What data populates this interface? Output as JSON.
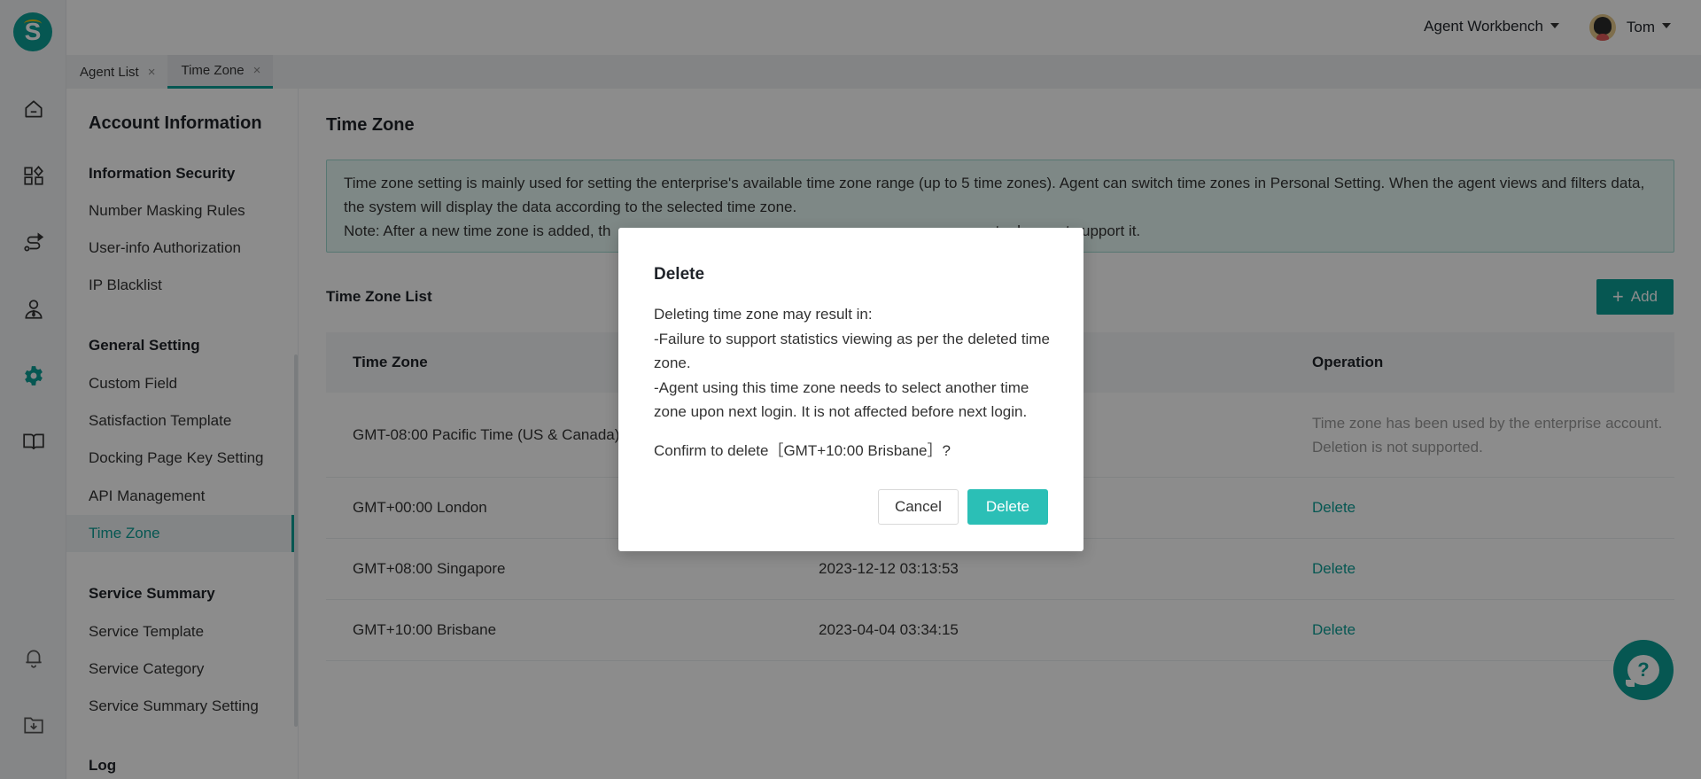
{
  "app": {
    "logo_letter": "S",
    "workbench_label": "Agent Workbench",
    "user_name": "Tom",
    "accent_color": "#0b9e96"
  },
  "rail": {
    "items": [
      {
        "icon": "home-icon",
        "active": false
      },
      {
        "icon": "apps-icon",
        "active": false
      },
      {
        "icon": "route-icon",
        "active": false
      },
      {
        "icon": "agent-icon",
        "active": false
      },
      {
        "icon": "gear-icon",
        "active": true
      },
      {
        "icon": "book-icon",
        "active": false
      }
    ],
    "bottom_items": [
      {
        "icon": "bell-icon"
      },
      {
        "icon": "download-folder-icon"
      }
    ]
  },
  "tabs": [
    {
      "label": "Agent List",
      "close": "×",
      "active": false
    },
    {
      "label": "Time Zone",
      "close": "×",
      "active": true
    }
  ],
  "sidebar": {
    "title": "Account Information",
    "groups": [
      {
        "label": "Information Security",
        "items": [
          "Number Masking Rules",
          "User-info Authorization",
          "IP Blacklist"
        ]
      },
      {
        "label": "General Setting",
        "items": [
          "Custom Field",
          "Satisfaction Template",
          "Docking Page Key Setting",
          "API Management",
          "Time Zone"
        ]
      },
      {
        "label": "Service Summary",
        "items": [
          "Service Template",
          "Service Category",
          "Service Summary Setting"
        ]
      },
      {
        "label": "Log",
        "items": []
      }
    ],
    "active_item": "Time Zone"
  },
  "main": {
    "title": "Time Zone",
    "notice_line1": "Time zone setting is mainly used for setting the enterprise's available time zone range (up to 5 time zones). Agent can switch time zones in Personal Setting. When the agent views and filters data, the system will display the data according to the selected time zone.",
    "notice_line2_visible_start": "Note: After a new time zone is added, th",
    "notice_line2_visible_end": "ata does not support it.",
    "list_title": "Time Zone List",
    "add_label": "Add",
    "add_icon": "+",
    "columns": [
      "Time Zone",
      "",
      "Operation"
    ],
    "rows": [
      {
        "time_zone": "GMT-08:00 Pacific Time (US & Canada)",
        "time": "",
        "operation": "Time zone has been used by the enterprise account. Deletion is not supported.",
        "op_type": "text"
      },
      {
        "time_zone": "GMT+00:00 London",
        "time": "",
        "operation": "Delete",
        "op_type": "link"
      },
      {
        "time_zone": "GMT+08:00 Singapore",
        "time": "2023-12-12 03:13:53",
        "operation": "Delete",
        "op_type": "link"
      },
      {
        "time_zone": "GMT+10:00 Brisbane",
        "time": "2023-04-04 03:34:15",
        "operation": "Delete",
        "op_type": "link"
      }
    ],
    "help_label": "?"
  },
  "modal": {
    "title": "Delete",
    "line1": "Deleting time zone may result in:",
    "line2": "-Failure to support statistics viewing as per the deleted time zone.",
    "line3": "-Agent using this time zone needs to select another time zone upon next login. It is not affected before next login.",
    "confirm": "Confirm to delete［GMT+10:00 Brisbane］?",
    "cancel_label": "Cancel",
    "delete_label": "Delete"
  }
}
